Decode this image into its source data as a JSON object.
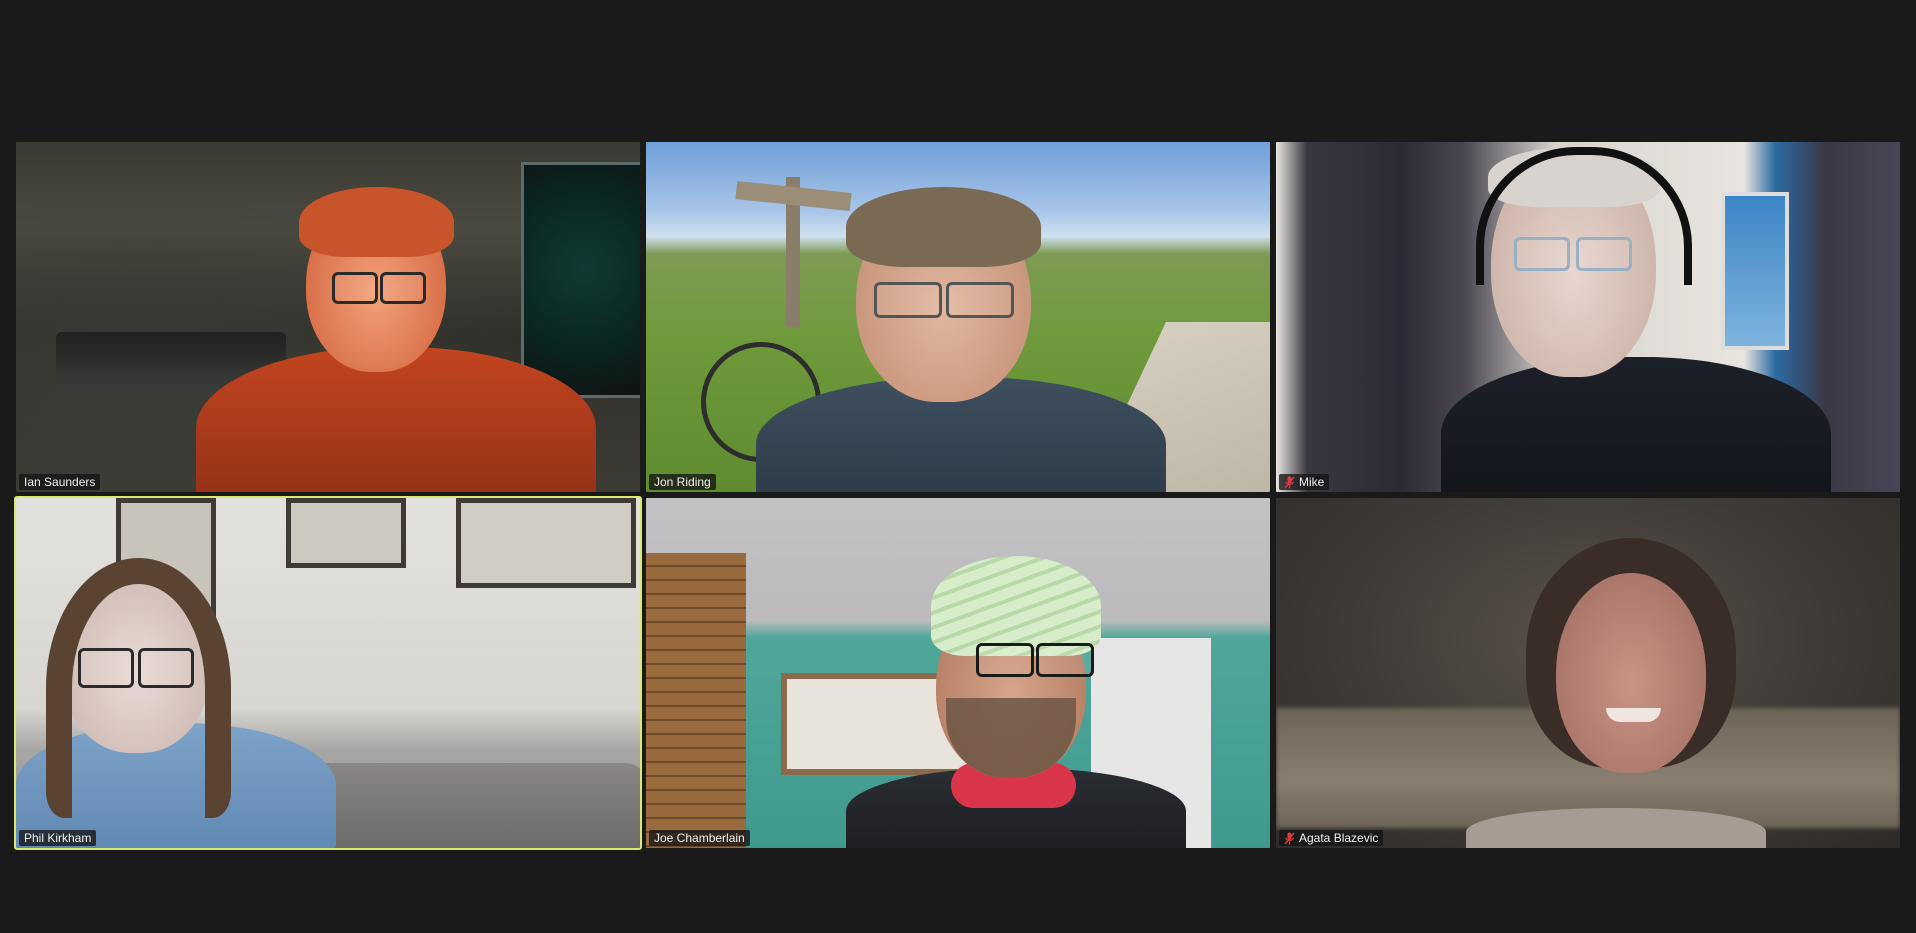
{
  "app": "Zoom meeting gallery view",
  "participants": [
    {
      "name": "Ian Saunders",
      "muted": false,
      "active_speaker": false
    },
    {
      "name": "Jon Riding",
      "muted": false,
      "active_speaker": false
    },
    {
      "name": "Mike",
      "muted": true,
      "active_speaker": false
    },
    {
      "name": "Phil Kirkham",
      "muted": false,
      "active_speaker": true
    },
    {
      "name": "Joe Chamberlain",
      "muted": false,
      "active_speaker": false
    },
    {
      "name": "Agata Blazevic",
      "muted": true,
      "active_speaker": false
    }
  ],
  "icons": {
    "muted": "microphone-muted-icon"
  },
  "colors": {
    "window_bg": "#1a1a1a",
    "active_speaker_border": "#d9e86f",
    "mute_icon": "#e0383e"
  }
}
